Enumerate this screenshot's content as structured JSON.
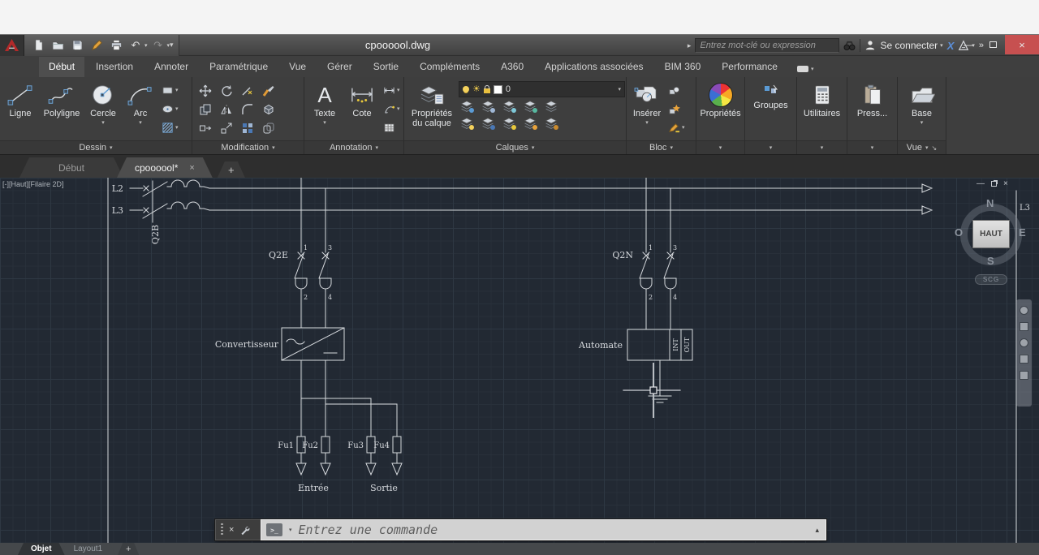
{
  "titlebar": {
    "title": "cpoooool.dwg",
    "search_placeholder": "Entrez mot-clé ou expression",
    "signin_label": "Se connecter"
  },
  "glyphs": {
    "caret_down": "▾",
    "caret_up": "▴",
    "prefix_arrow": "▸",
    "more_chevrons": "»",
    "undo": "↶",
    "redo": "↷",
    "minimize": "—",
    "close": "×",
    "plus": "+",
    "sun": "☀",
    "text_icon": "A",
    "prompt": ">_",
    "launcher": "↘"
  },
  "ribbon": {
    "tabs": [
      {
        "label": "Début",
        "active": true
      },
      {
        "label": "Insertion"
      },
      {
        "label": "Annoter"
      },
      {
        "label": "Paramétrique"
      },
      {
        "label": "Vue"
      },
      {
        "label": "Gérer"
      },
      {
        "label": "Sortie"
      },
      {
        "label": "Compléments"
      },
      {
        "label": "A360"
      },
      {
        "label": "Applications associées"
      },
      {
        "label": "BIM 360"
      },
      {
        "label": "Performance"
      }
    ],
    "dessin": {
      "label": "Dessin",
      "ligne": "Ligne",
      "polyligne": "Polyligne",
      "cercle": "Cercle",
      "arc": "Arc"
    },
    "modification": {
      "label": "Modification"
    },
    "annotation": {
      "label": "Annotation",
      "texte": "Texte",
      "cote": "Cote"
    },
    "calques": {
      "label": "Calques",
      "proprietes_l1": "Propriétés",
      "proprietes_l2": "du calque",
      "layer_value": "0"
    },
    "bloc": {
      "label": "Bloc",
      "inserer": "Insérer"
    },
    "proprietes": {
      "label": "Propriétés"
    },
    "groupes": {
      "label": "Groupes"
    },
    "utilitaires": {
      "label": "Utilitaires"
    },
    "presse": {
      "label": "Press..."
    },
    "vue": {
      "label": "Vue",
      "base": "Base"
    }
  },
  "file_tabs": {
    "tab_start": "Début",
    "tab_doc": "cpoooool*"
  },
  "drawing": {
    "viewport_label": "[-][Haut][Filaire 2D]",
    "wires": {
      "l2": "L2",
      "l3": "L3",
      "l3_right": "L3"
    },
    "components": {
      "q2b": "Q2B",
      "q2e": "Q2E",
      "q2n": "Q2N",
      "convertisseur": "Convertisseur",
      "automate": "Automate",
      "int": "INT",
      "out": "OUT",
      "t1": "1",
      "t2": "2",
      "t3": "3",
      "t4": "4",
      "fu1": "Fu1",
      "fu2": "Fu2",
      "fu3": "Fu3",
      "fu4": "Fu4",
      "entree": "Entrée",
      "sortie": "Sortie"
    },
    "viewcube": {
      "n": "N",
      "s": "S",
      "e": "E",
      "o": "O",
      "top": "HAUT",
      "scg": "SCG"
    }
  },
  "command_line": {
    "placeholder": "Entrez une commande"
  },
  "layout_tabs": {
    "objet": "Objet",
    "layout1": "Layout1"
  }
}
